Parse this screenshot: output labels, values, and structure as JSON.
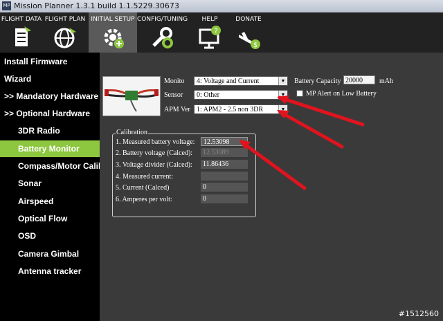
{
  "titlebar": {
    "icon_text": "MP",
    "title": "Mission Planner 1.3.1 build 1.1.5229.30673"
  },
  "menu": [
    {
      "label": "FLIGHT DATA",
      "icon": "flight-data-icon"
    },
    {
      "label": "FLIGHT PLAN",
      "icon": "flight-plan-globe-icon"
    },
    {
      "label": "INITIAL SETUP",
      "icon": "initial-setup-gear-icon"
    },
    {
      "label": "CONFIG/TUNING",
      "icon": "config-tuning-wrench-icon"
    },
    {
      "label": "HELP",
      "icon": "help-monitor-icon"
    },
    {
      "label": "DONATE",
      "icon": "donate-plane-icon"
    }
  ],
  "sidebar": {
    "items": [
      {
        "label": "Install Firmware"
      },
      {
        "label": "Wizard"
      },
      {
        "label": ">> Mandatory Hardware"
      },
      {
        "label": ">> Optional Hardware"
      },
      {
        "label": "3DR Radio"
      },
      {
        "label": "Battery Monitor"
      },
      {
        "label": "Compass/Motor Calib"
      },
      {
        "label": "Sonar"
      },
      {
        "label": "Airspeed"
      },
      {
        "label": "Optical Flow"
      },
      {
        "label": "OSD"
      },
      {
        "label": "Camera Gimbal"
      },
      {
        "label": "Antenna tracker"
      }
    ],
    "selected": "Battery Monitor"
  },
  "battery": {
    "monitor_label": "Monito",
    "monitor_value": "4: Voltage and Current",
    "sensor_label": "Sensor",
    "sensor_value": "0: Other",
    "apm_label": "APM Ver",
    "apm_value": "1: APM2 - 2.5 non 3DR",
    "capacity_label": "Battery Capacity",
    "capacity_value": "20000",
    "capacity_unit": "mAh",
    "alert_label": "MP Alert on Low Battery"
  },
  "calibration": {
    "title": "Calibration",
    "rows": [
      {
        "label": "1. Measured battery voltage:",
        "value": "12.53098"
      },
      {
        "label": "2. Battery voltage (Calced):",
        "value": "12.53089"
      },
      {
        "label": "3. Voltage divider (Calced):",
        "value": "11.86436"
      },
      {
        "label": "4. Measured current:",
        "value": ""
      },
      {
        "label": "5. Current (Calced)",
        "value": "0"
      },
      {
        "label": "6. Amperes per volt:",
        "value": "0"
      }
    ]
  },
  "annotation_color": "#e0141e",
  "watermark": "#1512560"
}
